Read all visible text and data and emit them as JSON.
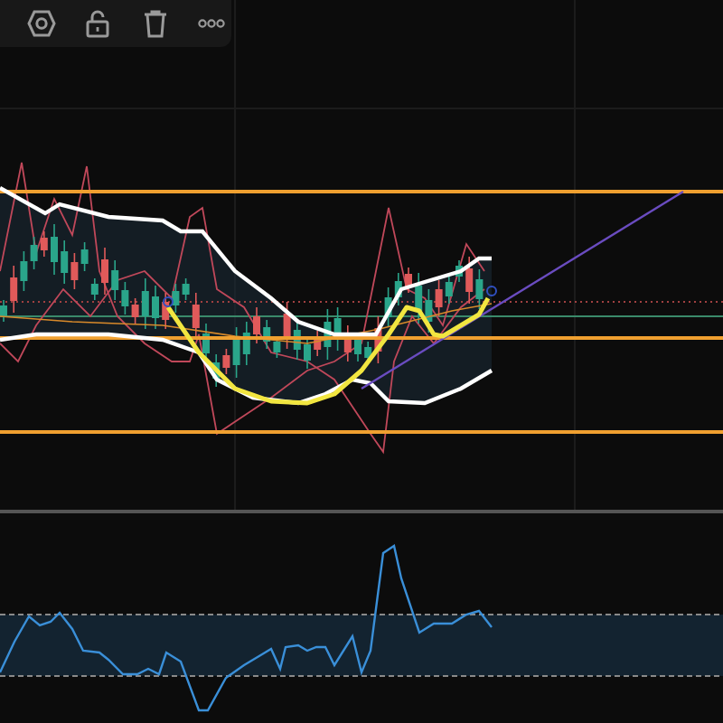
{
  "toolbar": {
    "buttons": [
      {
        "kind": "settings"
      },
      {
        "kind": "lock",
        "locked": false
      },
      {
        "kind": "delete"
      },
      {
        "kind": "more"
      }
    ]
  }
}
